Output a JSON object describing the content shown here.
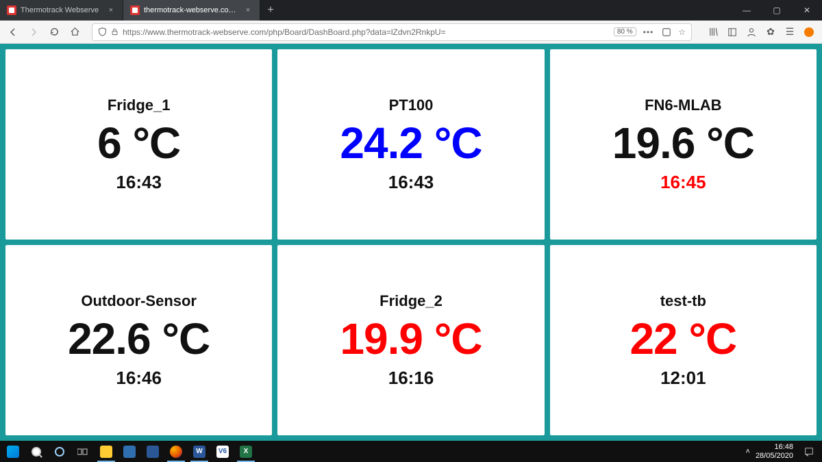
{
  "browser": {
    "tabs": [
      {
        "title": "Thermotrack Webserve"
      },
      {
        "title": "thermotrack-webserve.com/ph"
      }
    ],
    "url": "https://www.thermotrack-webserve.com/php/Board/DashBoard.php?data=lZdvn2RnkpU=",
    "zoom": "80 %"
  },
  "colors": {
    "page_bg": "#1a9a9a",
    "value_blue": "#0000ff",
    "value_red": "#ff0000"
  },
  "cards": [
    {
      "name": "Fridge_1",
      "value": "6 °C",
      "value_color": "black",
      "time": "16:43",
      "time_color": "black"
    },
    {
      "name": "PT100",
      "value": "24.2 °C",
      "value_color": "blue",
      "time": "16:43",
      "time_color": "black"
    },
    {
      "name": "FN6-MLAB",
      "value": "19.6 °C",
      "value_color": "black",
      "time": "16:45",
      "time_color": "red"
    },
    {
      "name": "Outdoor-Sensor",
      "value": "22.6 °C",
      "value_color": "black",
      "time": "16:46",
      "time_color": "black"
    },
    {
      "name": "Fridge_2",
      "value": "19.9 °C",
      "value_color": "red",
      "time": "16:16",
      "time_color": "black"
    },
    {
      "name": "test-tb",
      "value": "22 °C",
      "value_color": "red",
      "time": "12:01",
      "time_color": "black"
    }
  ],
  "taskbar": {
    "clock_time": "16:48",
    "clock_date": "28/05/2020",
    "v6_label": "V6"
  }
}
